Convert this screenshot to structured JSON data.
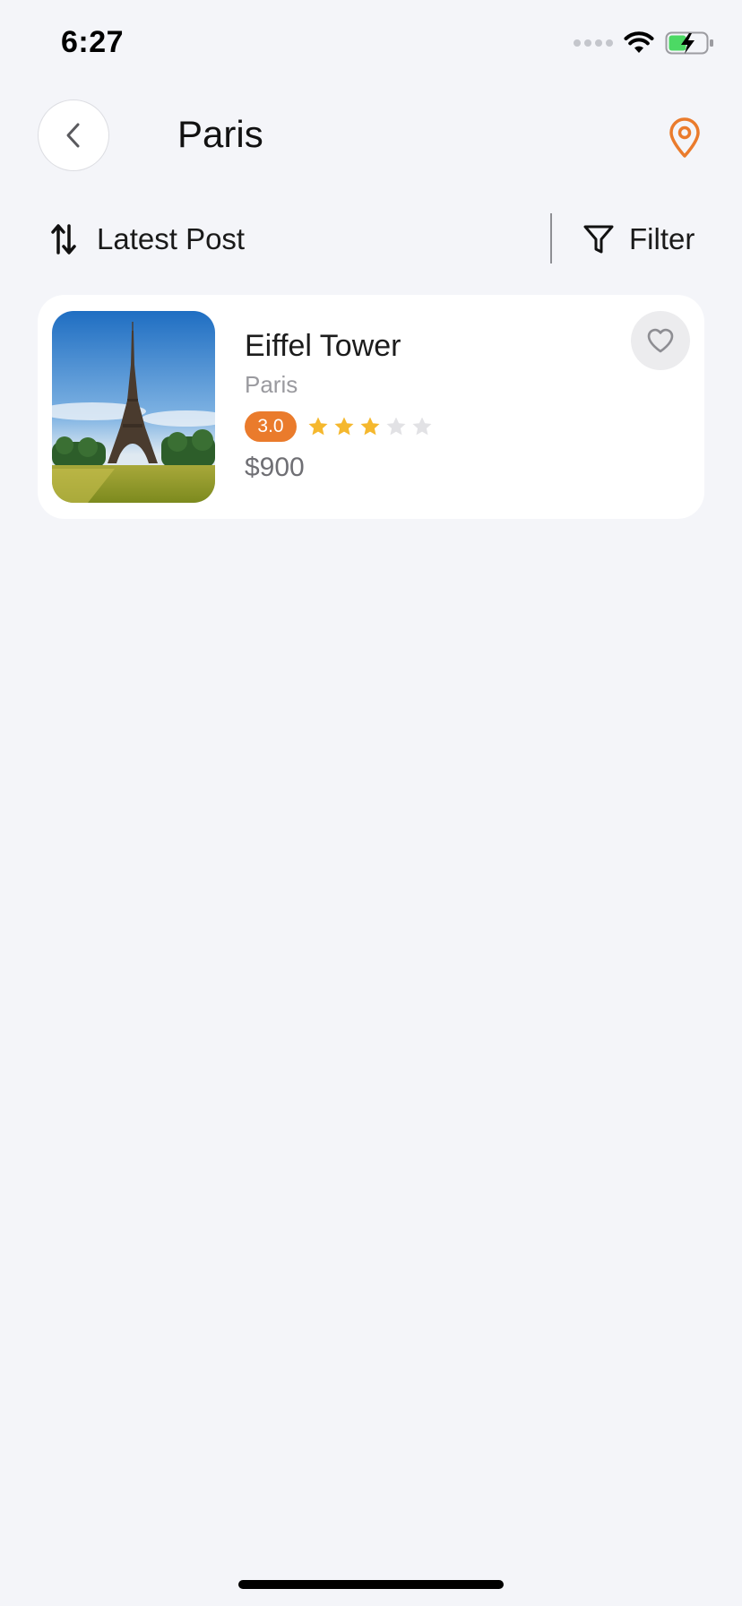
{
  "status_bar": {
    "time": "6:27",
    "icons": [
      "signal-dots-icon",
      "wifi-icon",
      "battery-charging-icon"
    ]
  },
  "header": {
    "title": "Paris",
    "back_icon": "chevron-left-icon",
    "location_icon": "map-pin-icon",
    "accent_color": "#ea7b2c"
  },
  "toolbar": {
    "sort_label": "Latest Post",
    "sort_icon": "sort-arrows-icon",
    "filter_label": "Filter",
    "filter_icon": "funnel-icon"
  },
  "places": [
    {
      "name": "Eiffel Tower",
      "location": "Paris",
      "rating": "3.0",
      "stars_filled": 3,
      "stars_total": 5,
      "price": "$900",
      "image": "eiffel-tower-photo",
      "favorite_icon": "heart-outline-icon"
    }
  ],
  "colors": {
    "background": "#f4f5f9",
    "card": "#ffffff",
    "rating_badge": "#ea7b2c",
    "star_filled": "#f5b82e",
    "star_empty": "#e2e2e5"
  }
}
